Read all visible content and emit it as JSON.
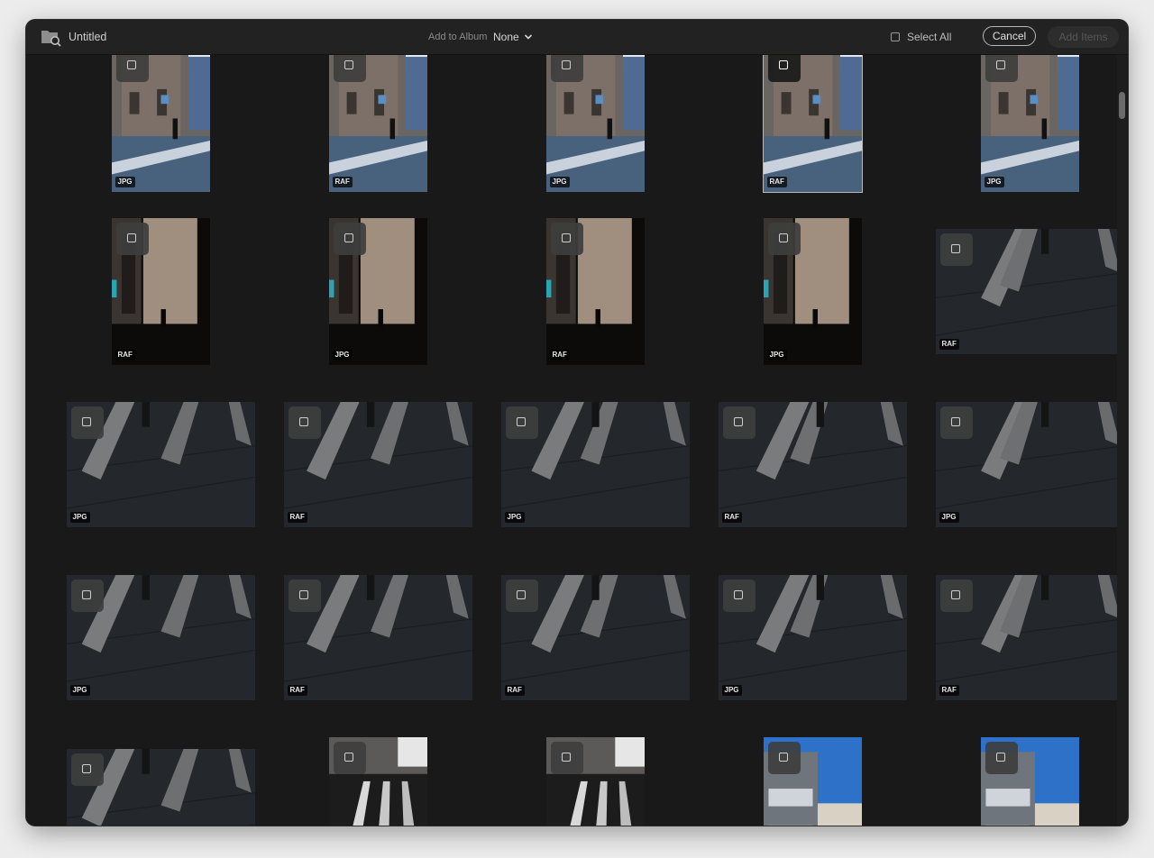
{
  "header": {
    "title": "Untitled",
    "add_to_album_label": "Add to Album",
    "album_value": "None",
    "select_all_label": "Select All",
    "cancel_label": "Cancel",
    "add_items_label": "Add Items"
  },
  "colors": {
    "window_bg": "#191919",
    "topbar_bg": "#222222",
    "badge_bg": "#000000"
  },
  "icons": {
    "folder": "folder-search-icon",
    "dropdown": "chevron-down-icon",
    "checkbox": "checkbox-icon"
  },
  "photos": [
    {
      "format": "JPG",
      "scene": "church",
      "selected": false
    },
    {
      "format": "RAF",
      "scene": "church",
      "selected": false
    },
    {
      "format": "JPG",
      "scene": "church",
      "selected": false
    },
    {
      "format": "RAF",
      "scene": "church",
      "selected": true
    },
    {
      "format": "JPG",
      "scene": "church",
      "selected": false
    },
    {
      "format": "RAF",
      "scene": "wall",
      "selected": false
    },
    {
      "format": "JPG",
      "scene": "wall",
      "selected": false
    },
    {
      "format": "RAF",
      "scene": "wall",
      "selected": false
    },
    {
      "format": "JPG",
      "scene": "wall",
      "selected": false
    },
    {
      "format": "RAF",
      "scene": "shadows",
      "selected": false
    },
    {
      "format": "JPG",
      "scene": "shadows",
      "selected": false
    },
    {
      "format": "RAF",
      "scene": "shadows",
      "selected": false
    },
    {
      "format": "JPG",
      "scene": "shadows",
      "selected": false
    },
    {
      "format": "RAF",
      "scene": "shadows",
      "selected": false
    },
    {
      "format": "JPG",
      "scene": "shadows",
      "selected": false
    },
    {
      "format": "JPG",
      "scene": "shadows",
      "selected": false
    },
    {
      "format": "RAF",
      "scene": "shadows",
      "selected": false
    },
    {
      "format": "RAF",
      "scene": "shadows",
      "selected": false
    },
    {
      "format": "JPG",
      "scene": "shadows",
      "selected": false
    },
    {
      "format": "RAF",
      "scene": "shadows",
      "selected": false
    },
    {
      "format": "",
      "scene": "shadows",
      "selected": false
    },
    {
      "format": "",
      "scene": "street",
      "selected": false
    },
    {
      "format": "",
      "scene": "street",
      "selected": false
    },
    {
      "format": "",
      "scene": "buildings",
      "selected": false
    },
    {
      "format": "",
      "scene": "buildings",
      "selected": false
    }
  ]
}
